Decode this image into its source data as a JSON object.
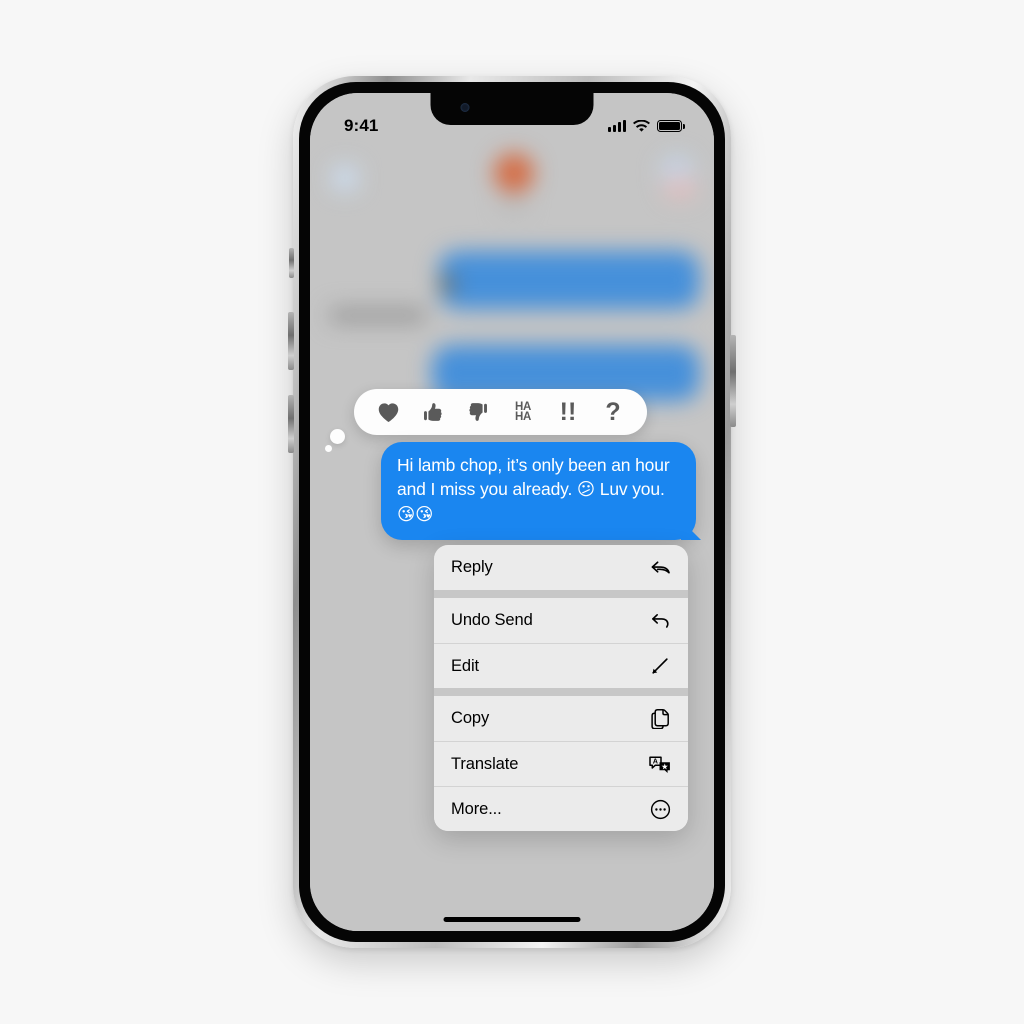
{
  "canvas": {
    "background": "#f7f7f7"
  },
  "device": {
    "name": "iPhone",
    "frame_color": "#c9c9c9",
    "buttons": [
      "silent-switch",
      "volume-up",
      "volume-down",
      "power"
    ]
  },
  "status_bar": {
    "time": "9:41",
    "cellular_icon": "signal-bars-icon",
    "wifi_icon": "wifi-icon",
    "battery_icon": "battery-full-icon"
  },
  "conversation": {
    "blurred_background": true,
    "back_icon": "back-chevron-icon",
    "contact_avatar": "contact-avatar",
    "facetime_icon": "facetime-icon"
  },
  "tapback": {
    "items": [
      {
        "id": "heart",
        "label": "Heart",
        "icon": "heart-icon"
      },
      {
        "id": "thumbs-up",
        "label": "Thumbs Up",
        "icon": "thumbs-up-icon"
      },
      {
        "id": "thumbs-down",
        "label": "Thumbs Down",
        "icon": "thumbs-down-icon"
      },
      {
        "id": "haha",
        "label": "Haha",
        "icon": "haha-icon",
        "line1": "HA",
        "line2": "HA"
      },
      {
        "id": "exclamation",
        "label": "Exclamation",
        "icon": "double-exclamation-icon",
        "glyph": "!!"
      },
      {
        "id": "question",
        "label": "Question",
        "icon": "question-mark-icon",
        "glyph": "?"
      }
    ]
  },
  "message": {
    "text_line_1": "Hi lamb chop, it’s only been an",
    "text_line_2": "hour and I miss you already. ",
    "emoji_confused": "😕",
    "text_line_3": "Luv you. ",
    "emoji_kiss_1": "😘",
    "emoji_kiss_2": "😘",
    "bubble_color": "#1a86f0",
    "text_color": "#ffffff",
    "sender": "outgoing"
  },
  "context_menu": {
    "groups": [
      {
        "items": [
          {
            "label": "Reply",
            "icon": "reply-arrow-icon"
          }
        ]
      },
      {
        "items": [
          {
            "label": "Undo Send",
            "icon": "undo-arrow-icon"
          },
          {
            "label": "Edit",
            "icon": "pencil-icon"
          }
        ]
      },
      {
        "items": [
          {
            "label": "Copy",
            "icon": "copy-pages-icon"
          },
          {
            "label": "Translate",
            "icon": "translate-bubbles-icon"
          },
          {
            "label": "More...",
            "icon": "ellipsis-circle-icon"
          }
        ]
      }
    ]
  },
  "home_indicator": {
    "visible": true
  }
}
